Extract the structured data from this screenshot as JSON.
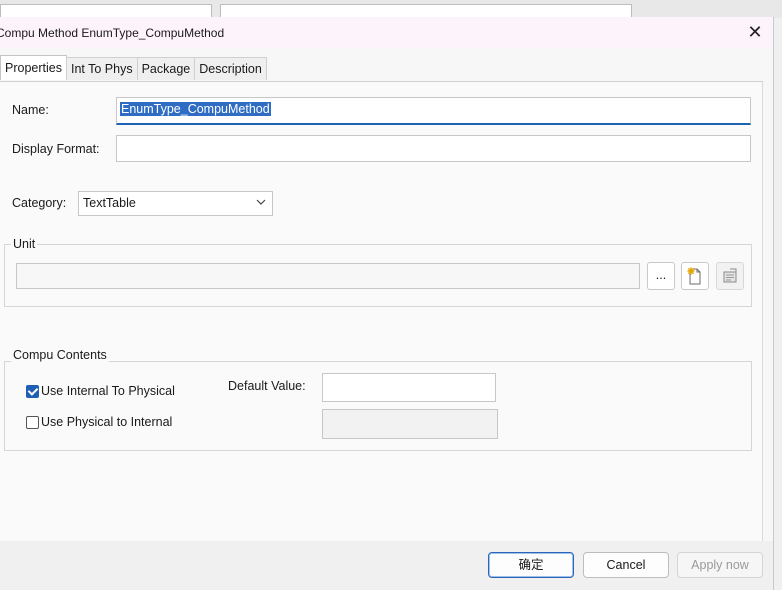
{
  "dialog": {
    "title": "Compu Method EnumType_CompuMethod",
    "close_glyph": "✕"
  },
  "tabs": [
    {
      "label": "Properties",
      "active": true
    },
    {
      "label": "Int To Phys",
      "active": false
    },
    {
      "label": "Package",
      "active": false
    },
    {
      "label": "Description",
      "active": false
    }
  ],
  "properties": {
    "name_label": "Name:",
    "name_value": "EnumType_CompuMethod",
    "display_format_label": "Display Format:",
    "display_format_value": "",
    "category_label": "Category:",
    "category_value": "TextTable",
    "unit": {
      "title": "Unit",
      "value": "",
      "browse_label": "...",
      "new_icon": "new-document-icon",
      "edit_icon": "properties-icon"
    },
    "compu_contents": {
      "title": "Compu Contents",
      "use_int_to_phys_label": "Use Internal To Physical",
      "use_int_to_phys_checked": true,
      "use_phys_to_int_label": "Use Physical to Internal",
      "use_phys_to_int_checked": false,
      "default_value_label": "Default Value:",
      "default_value": ""
    }
  },
  "footer": {
    "ok_label": "确定",
    "cancel_label": "Cancel",
    "apply_label": "Apply now"
  },
  "colors": {
    "accent": "#1e62b3",
    "selection": "#2f6dc4",
    "titlebar": "#fdf3fb"
  }
}
